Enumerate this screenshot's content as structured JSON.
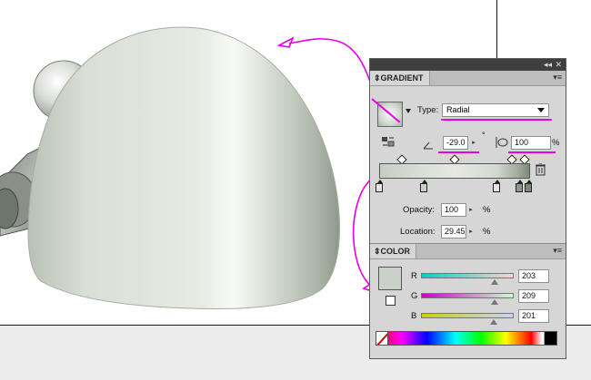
{
  "gradient_panel": {
    "tab_label": "GRADIENT",
    "type_label": "Type:",
    "type_value": "Radial",
    "angle_value": "-29.0",
    "degree_symbol": "°",
    "aspect_value": "100",
    "percent_symbol": "%",
    "opacity_label": "Opacity:",
    "opacity_value": "100",
    "location_label": "Location:",
    "location_value": "29.45"
  },
  "color_panel": {
    "tab_label": "COLOR",
    "r_label": "R",
    "r_value": "203",
    "g_label": "G",
    "g_value": "209",
    "b_label": "B",
    "b_value": "201",
    "swatch_color": "#cbd1c9"
  },
  "panel_controls": {
    "collapse": "◂◂",
    "close": "✕",
    "menu": "▾≡"
  },
  "colors": {
    "annotation": "#e600e6",
    "object_light": "#eef2ec",
    "object_dark": "#9aa496"
  }
}
